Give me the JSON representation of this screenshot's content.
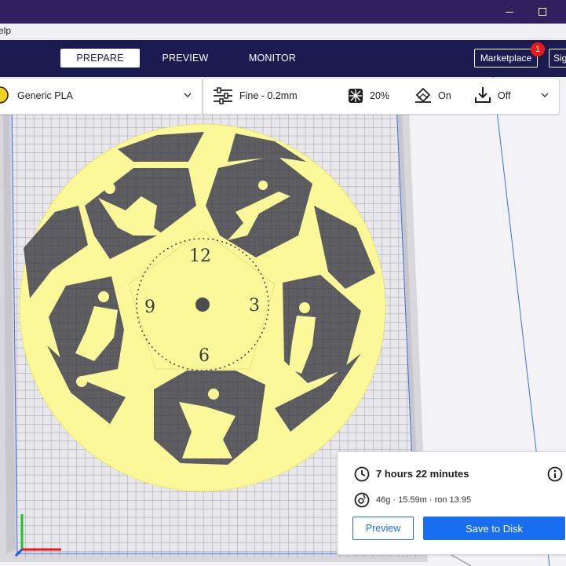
{
  "window": {
    "minimize_icon": "minimize-icon",
    "maximize_icon": "maximize-icon"
  },
  "menu": {
    "help_partial": "elp"
  },
  "stages": {
    "prepare": "PREPARE",
    "preview": "PREVIEW",
    "monitor": "MONITOR"
  },
  "header": {
    "marketplace": "Marketplace",
    "marketplace_badge": "1",
    "signin_partial": "Sig"
  },
  "toolbar": {
    "material": "Generic PLA",
    "profile": "Fine - 0.2mm",
    "infill": "20%",
    "support": "On",
    "adhesion": "Off"
  },
  "estimate": {
    "time": "7 hours 22 minutes",
    "material": "46g · 15.59m · ron 13.95",
    "preview_button": "Preview",
    "save_button": "Save to Disk"
  },
  "model": {
    "clock_numbers": [
      "12",
      "3",
      "6",
      "9"
    ]
  },
  "colors": {
    "brand_dark": "#1b1b52",
    "title_bar": "#30205e",
    "accent_blue": "#196ef0",
    "model_yellow": "#fbf89a",
    "badge_red": "#e51a1a"
  }
}
